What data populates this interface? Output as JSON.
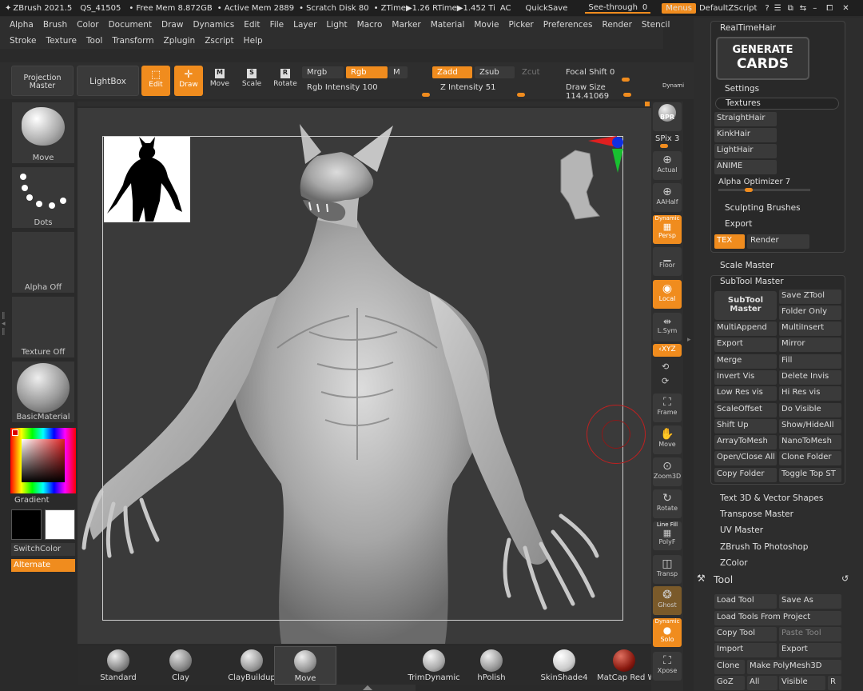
{
  "titlebar": {
    "app": "ZBrush 2021.5",
    "qs": "QS_41505",
    "free_mem": "• Free Mem 8.872GB",
    "active_mem": "• Active Mem 2889",
    "scratch": "• Scratch Disk 80",
    "ztime": "• ZTime▶1.26 RTime▶1.452 Ti",
    "ac": "AC",
    "quicksave": "QuickSave",
    "see_through_label": "See-through",
    "see_through_value": "0",
    "menus": "Menus",
    "script": "DefaultZScript"
  },
  "menu_row1": [
    "Alpha",
    "Brush",
    "Color",
    "Document",
    "Draw",
    "Dynamics",
    "Edit",
    "File",
    "Layer",
    "Light",
    "Macro",
    "Marker",
    "Material",
    "Movie",
    "Picker",
    "Preferences",
    "Render",
    "Stencil"
  ],
  "menu_row2": [
    "Stroke",
    "Texture",
    "Tool",
    "Transform",
    "Zplugin",
    "Zscript",
    "Help"
  ],
  "toolbar": {
    "projection_master": "Projection Master",
    "lightbox": "LightBox",
    "edit": "Edit",
    "draw": "Draw",
    "move": "Move",
    "scale": "Scale",
    "rotate": "Rotate",
    "mrgb": "Mrgb",
    "rgb": "Rgb",
    "m": "M",
    "rgb_intensity": "Rgb Intensity 100",
    "zadd": "Zadd",
    "zsub": "Zsub",
    "zcut": "Zcut",
    "z_intensity": "Z Intensity 51",
    "focal_shift": "Focal Shift 0",
    "draw_size": "Draw Size 114.41069",
    "dynamic": "Dynami"
  },
  "left_shelf": {
    "brush": "Move",
    "stroke": "Dots",
    "alpha": "Alpha Off",
    "texture": "Texture Off",
    "material": "BasicMaterial",
    "gradient": "Gradient",
    "switch_color": "SwitchColor",
    "alternate": "Alternate"
  },
  "right_shelf": {
    "bpr": "BPR",
    "spix": "SPix 3",
    "actual": "Actual",
    "aahalf": "AAHalf",
    "dynamic_label": "Dynamic",
    "persp": "Persp",
    "floor": "Floor",
    "local": "Local",
    "lsym": "L.Sym",
    "xyz": "‹XYZ",
    "frame": "Frame",
    "move": "Move",
    "zoom3d": "Zoom3D",
    "rotate": "Rotate",
    "line_fill": "Line Fill",
    "polyf": "PolyF",
    "transp": "Transp",
    "ghost": "Ghost",
    "dynamic2": "Dynamic",
    "solo": "Solo",
    "xpose": "Xpose"
  },
  "rpanel": {
    "realtimehair": "RealTimeHair",
    "generate_cards_1": "GENERATE",
    "generate_cards_2": "CARDS",
    "settings": "Settings",
    "textures": "Textures",
    "hair_items": [
      "StraightHair",
      "KinkHair",
      "LightHair",
      "ANIME"
    ],
    "alpha_optimizer": "Alpha Optimizer 7",
    "sculpting_brushes": "Sculpting Brushes",
    "export": "Export",
    "tex": "TEX",
    "render": "Render",
    "scale_master": "Scale Master",
    "subtool_master": "SubTool Master",
    "subtool_master_btn": "SubTool Master",
    "subtool_left": [
      "MultiAppend",
      "Export",
      "Merge",
      "Invert Vis",
      "Low Res vis",
      "ScaleOffset",
      "Shift Up",
      "ArrayToMesh",
      "Open/Close All",
      "Copy Folder"
    ],
    "subtool_right_top": [
      "Save ZTool",
      "Folder Only"
    ],
    "subtool_right": [
      "MultiInsert",
      "Mirror",
      "Fill",
      "Delete Invis",
      "Hi Res vis",
      "Do Visible",
      "Show/HideAll",
      "NanoToMesh",
      "Clone Folder",
      "Toggle Top ST"
    ],
    "plugins": [
      "Text 3D & Vector Shapes",
      "Transpose Master",
      "UV Master",
      "ZBrush To Photoshop",
      "ZColor"
    ],
    "tool": "Tool",
    "load_tool": "Load Tool",
    "save_as": "Save As",
    "load_tools_from_project": "Load Tools From Project",
    "copy_tool": "Copy Tool",
    "paste_tool": "Paste Tool",
    "import": "Import",
    "export2": "Export",
    "clone": "Clone",
    "make_polymesh": "Make PolyMesh3D",
    "goz": "GoZ",
    "all": "All",
    "visible": "Visible",
    "r": "R"
  },
  "brushes": [
    "Standard",
    "Clay",
    "ClayBuildup",
    "Move",
    "TrimDynamic",
    "hPolish",
    "SkinShade4",
    "MatCap Red W"
  ],
  "colors": {
    "accent": "#f08c1e",
    "primary_swatch": "#000000",
    "secondary_swatch": "#ffffff"
  }
}
